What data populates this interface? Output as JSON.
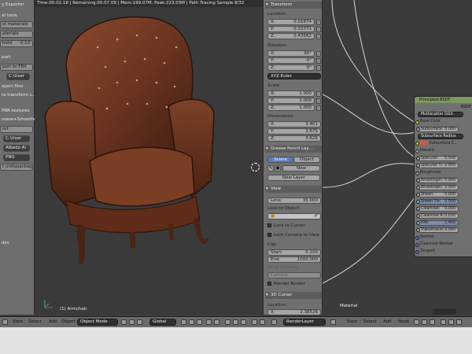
{
  "left_panel": {
    "title": "y Exporter",
    "label_1": "al tools",
    "btn_1": "st materials",
    "btn_2": "aterials",
    "field_label": "hold:",
    "field_value": "0.10",
    "label_2": "port",
    "btn_3": "port to FBX",
    "path_1": "C:\\User",
    "label_3": "xport files",
    "label_4": "to transform c…",
    "label_5": "PBR textures",
    "label_6": "rease+Smoothn…",
    "btn_4": "ort",
    "path_2": "C:\\User",
    "select_1": "Albedo Al",
    "select_2": "PNG",
    "btn_5": "t unitypackage",
    "label_7": "des"
  },
  "viewport": {
    "header": "Time:00:02.18 | Remaining:00:07.09 | Mem:199.07M, Peak:223.03M | Path Tracing Sample 8/32",
    "object_name": "(1) Armchair"
  },
  "properties": {
    "transform": "Transform",
    "location": "Location:",
    "loc": [
      {
        "axis": "X:",
        "value": "0.01874"
      },
      {
        "axis": "Y:",
        "value": "0.33771"
      },
      {
        "axis": "Z:",
        "value": "0.43562"
      }
    ],
    "rotation": "Rotation:",
    "rot": [
      {
        "axis": "X:",
        "value": "90°"
      },
      {
        "axis": "Y:",
        "value": "-0°"
      },
      {
        "axis": "Z:",
        "value": "0°"
      }
    ],
    "rotation_mode": "XYZ Euler",
    "scale": "Scale:",
    "scl": [
      {
        "axis": "X:",
        "value": "1.000"
      },
      {
        "axis": "Y:",
        "value": "1.000"
      },
      {
        "axis": "Z:",
        "value": "1.000"
      }
    ],
    "dimensions": "Dimensions:",
    "dim": [
      {
        "axis": "X:",
        "value": "3.461"
      },
      {
        "axis": "Y:",
        "value": "3.675"
      },
      {
        "axis": "Z:",
        "value": "3.625"
      }
    ],
    "grease_pencil": "Grease Pencil Lay…",
    "scene_btn": "Scene",
    "object_btn": "Object",
    "new_btn": "New",
    "new_layer_btn": "New Layer",
    "view": "View",
    "lens_label": "Lens:",
    "lens_value": "35.000",
    "lock_to_object": "Lock to Object:",
    "lock_to_cursor": "Lock to Cursor",
    "lock_camera": "Lock Camera to View",
    "clip": "Clip:",
    "clip_start_label": "Start:",
    "clip_start": "0.100",
    "clip_end_label": "End:",
    "clip_end": "1000.000",
    "local_camera": "Local Camera:",
    "camera_field": "Camera",
    "render_border": "Render Border",
    "cursor_3d": "3D Cursor",
    "cursor_location": "Location:",
    "cursor_x_label": "X:",
    "cursor_x": "2.38526"
  },
  "node": {
    "title": "Principled BSDF",
    "output": "BSDF",
    "distribution": "Multiscatter GGX",
    "base_color": "Base Color",
    "subsurface_label": "Subsurface:",
    "subsurface": "0.000",
    "subsurface_method": "Subsurface Radius",
    "subsurface_color": "Subsurface C…",
    "metallic": "Metallic",
    "specular_label": "Specular:",
    "specular": "0.500",
    "specular_tint_label": "Specular Ti:",
    "specular_tint": "0.000",
    "roughness": "Roughness",
    "anisotropic_label": "Anisotropic:",
    "anisotropic": "0.000",
    "anisotropic_rot_label": "Anisotropic:",
    "anisotropic_rot": "0.000",
    "sheen_label": "Sheen:",
    "sheen": "0.000",
    "sheen_tint_label": "Sheen Tin:",
    "sheen_tint": "0.500",
    "clearcoat_label": "Clearcoat:",
    "clearcoat": "0.000",
    "clearcoat_rough_label": "Clearcoat R:",
    "clearcoat_rough": "0.030",
    "ior_label": "IOR:",
    "ior": "1.450",
    "transmission_label": "Transmissio:",
    "transmission": "0.000",
    "normal": "Normal",
    "clearcoat_normal": "Clearcoat Normal",
    "tangent": "Tangent",
    "footer": "Material"
  },
  "status_bar": {
    "view": "View",
    "select": "Select",
    "add": "Add",
    "object": "Object",
    "mode": "Object Mode",
    "pivot": "Global",
    "render_layer": "RenderLayer",
    "view2": "View",
    "select2": "Select",
    "add2": "Add",
    "node": "Node"
  },
  "colors": {
    "subsurface_swatch": "#d8563e",
    "node_header": "#7e965f",
    "socket_yellow": "#c7c729",
    "socket_gray": "#a1a1a1",
    "socket_purple": "#6363c7"
  }
}
